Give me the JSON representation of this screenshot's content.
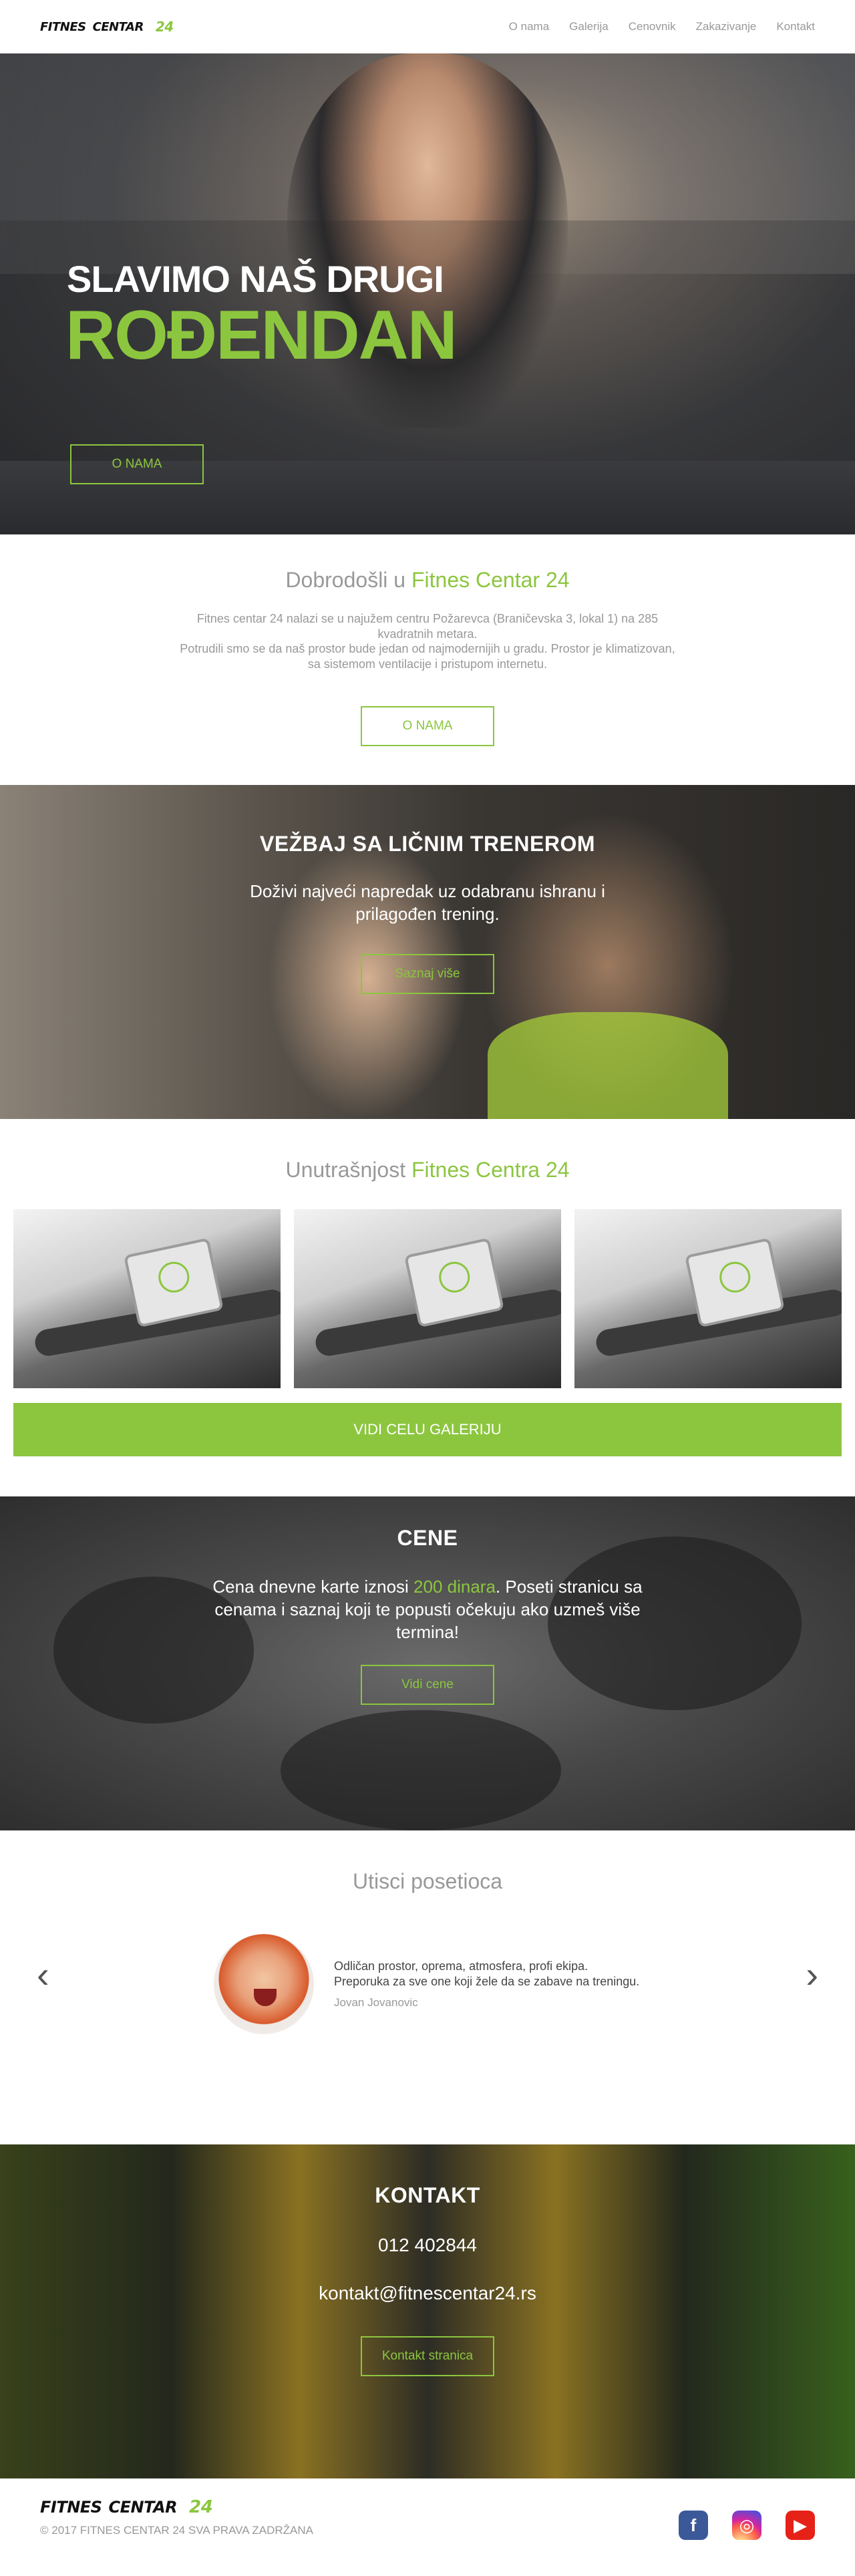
{
  "nav": {
    "logo": {
      "word1": "FITNES",
      "word2": "CENTAR",
      "num": "24"
    },
    "items": [
      "O nama",
      "Galerija",
      "Cenovnik",
      "Zakazivanje",
      "Kontakt"
    ]
  },
  "hero": {
    "line1": "SLAVIMO NAŠ DRUGI",
    "line2": "ROĐENDAN",
    "button": "O NAMA"
  },
  "welcome": {
    "title_prefix": "Dobrodošli u ",
    "title_highlight": "Fitnes Centar 24",
    "text1": "Fitnes centar 24 nalazi se u najužem centru Požarevca (Braničevska 3, lokal 1) na 285 kvadratnih metara.",
    "text2": "Potrudili smo se da naš prostor bude jedan od najmodernijih u gradu. Prostor je klimatizovan, sa sistemom ventilacije i pristupom internetu.",
    "button": "O NAMA"
  },
  "trainer": {
    "title": "VEŽBAJ SA LIČNIM TRENEROM",
    "text": "Doživi najveći napredak uz odabranu ishranu i prilagođen trening.",
    "button": "Saznaj više"
  },
  "gallery": {
    "title_prefix": "Unutrašnjost ",
    "title_highlight": "Fitnes Centra 24",
    "button": "VIDI CELU GALERIJU"
  },
  "prices": {
    "title": "CENE",
    "text_before": "Cena dnevne karte iznosi ",
    "highlight": "200 dinara",
    "text_after": ". Poseti stranicu sa cenama i saznaj koji te popusti očekuju ako uzmeš više termina!",
    "button": "Vidi cene"
  },
  "testimonials": {
    "title": "Utisci posetioca",
    "quote": "Odličan prostor, oprema, atmosfera, profi ekipa. Preporuka za sve one koji žele da se zabave na treningu.",
    "author": "Jovan Jovanovic",
    "prev_icon": "‹",
    "next_icon": "›"
  },
  "contact": {
    "title": "KONTAKT",
    "phone": "012 402844",
    "email": "kontakt@fitnescentar24.rs",
    "button": "Kontakt stranica"
  },
  "footer": {
    "logo": {
      "word1": "FITNES",
      "word2": "CENTAR",
      "num": "24"
    },
    "copyright": "© 2017 FITNES CENTAR 24 SVA PRAVA ZADRŽANA",
    "socials": [
      {
        "name": "facebook",
        "glyph": "f"
      },
      {
        "name": "instagram",
        "glyph": "◎"
      },
      {
        "name": "youtube",
        "glyph": "▶"
      }
    ]
  },
  "colors": {
    "accent": "#8cc63f",
    "text_muted": "#999999"
  }
}
